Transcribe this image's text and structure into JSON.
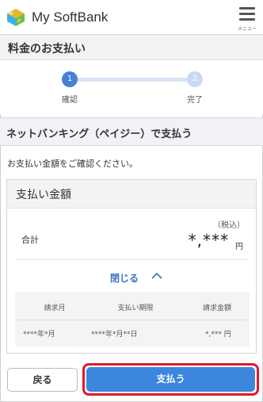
{
  "header": {
    "app_title": "My SoftBank",
    "menu_label": "メニュー"
  },
  "page": {
    "title": "料金のお支払い"
  },
  "stepper": {
    "steps": [
      {
        "number": "1",
        "label": "確認",
        "state": "active"
      },
      {
        "number": "2",
        "label": "完了",
        "state": "inactive"
      }
    ]
  },
  "section": {
    "title": "ネットバンキング（ペイジー）で支払う",
    "confirm_text": "お支払い金額をご確認ください。"
  },
  "amount_card": {
    "heading": "支払い金額",
    "tax_note": "（税込）",
    "total_label": "合計",
    "total_value": "*,***",
    "total_unit": "円",
    "collapse_label": "閉じる",
    "table": {
      "headers": [
        "請求月",
        "支払い期限",
        "請求金額"
      ],
      "rows": [
        [
          "****年*月",
          "****年*月**日",
          "*,*** 円"
        ]
      ]
    }
  },
  "buttons": {
    "back_label": "戻る",
    "pay_label": "支払う"
  },
  "colors": {
    "accent": "#3d86de",
    "highlight": "#e0192b",
    "link": "#3b72c4"
  }
}
